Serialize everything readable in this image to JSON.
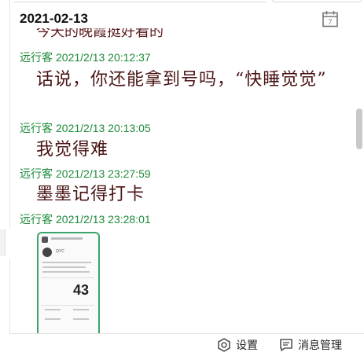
{
  "header": {
    "date": "2021-02-13"
  },
  "icons": {
    "calendar_day": "7",
    "calendar": "calendar-icon",
    "settings": "settings-icon",
    "message": "message-icon"
  },
  "messages": [
    {
      "id": "clip",
      "text": "今天的晚霞挺好看的",
      "partial": true
    },
    {
      "author": "远行客",
      "time": "2021/2/13 20:12:37",
      "text": "话说，你还能拿到号吗，“快睡觉觉”"
    },
    {
      "author": "远行客",
      "time": "2021/2/13 20:13:05",
      "text": "我觉得难"
    },
    {
      "author": "远行客",
      "time": "2021/2/13 23:27:59",
      "text": "墨墨记得打卡"
    },
    {
      "author": "远行客",
      "time": "2021/2/13 23:28:01",
      "image": {
        "number": "43",
        "name": "QYC"
      }
    }
  ],
  "footer": {
    "settings_label": "设置",
    "message_mgmt_label": "消息管理"
  },
  "colors": {
    "author": "#1e8a3a",
    "message": "#4a1414",
    "photo_border": "#3aa56a"
  }
}
